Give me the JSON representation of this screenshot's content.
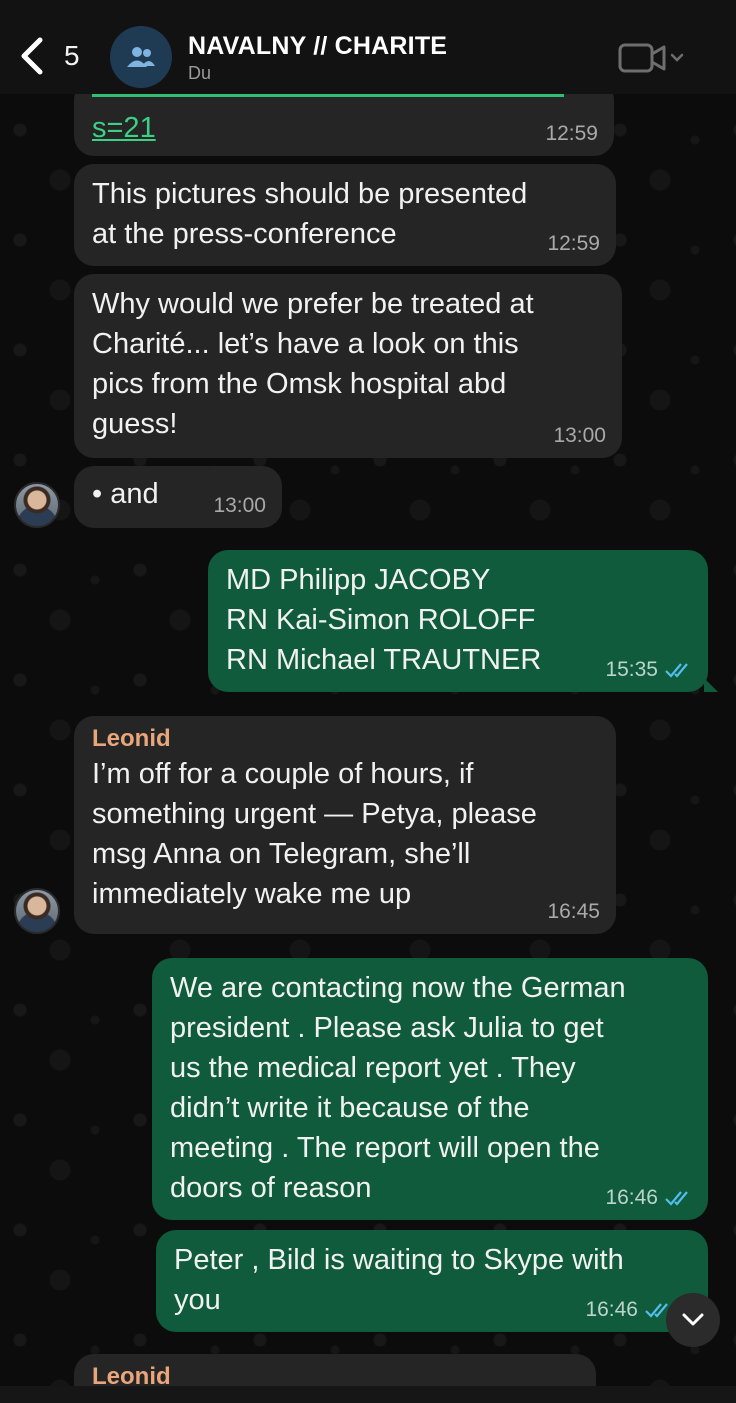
{
  "header": {
    "back_count": "5",
    "title": "NAVALNY // CHARITE",
    "subtitle": "Du",
    "icons": {
      "back": "chevron-left-icon",
      "group": "group-icon",
      "video": "video-call-icon"
    }
  },
  "messages": [
    {
      "direction": "in",
      "text": "s=21",
      "time": "12:59",
      "is_link": true
    },
    {
      "direction": "in",
      "text": "This pictures should be presented\nat the press-conference",
      "time": "12:59"
    },
    {
      "direction": "in",
      "text": "Why would we prefer be treated at\nCharité... let’s have a look on this\npics from the Omsk hospital abd\nguess!",
      "time": "13:00"
    },
    {
      "direction": "in",
      "text": "• and",
      "time": "13:00"
    },
    {
      "direction": "out",
      "text": "MD Philipp JACOBY\nRN Kai-Simon ROLOFF\nRN Michael TRAUTNER",
      "time": "15:35",
      "status": "read"
    },
    {
      "direction": "in",
      "sender": "Leonid",
      "text": "I’m off for a couple of hours, if\nsomething urgent — Petya, please\nmsg Anna on Telegram, she’ll\nimmediately wake me up",
      "time": "16:45"
    },
    {
      "direction": "out",
      "text": "We are contacting now the German\npresident . Please ask Julia to get\nus the medical report yet . They\ndidn’t write it because of the\nmeeting . The report will open the\ndoors of reason",
      "time": "16:46",
      "status": "read"
    },
    {
      "direction": "out",
      "text": "Peter , Bild is waiting to Skype with\nyou",
      "time": "16:46",
      "status": "read"
    },
    {
      "direction": "in",
      "sender": "Leonid",
      "text": "",
      "time": ""
    }
  ],
  "colors": {
    "incoming_bubble": "#252525",
    "outgoing_bubble": "#0f5b3c",
    "sender_name": "#e9a57c",
    "read_ticks": "#53bdeb",
    "link": "#3ccf86"
  },
  "controls": {
    "scroll_down_icon": "chevron-down-icon"
  }
}
